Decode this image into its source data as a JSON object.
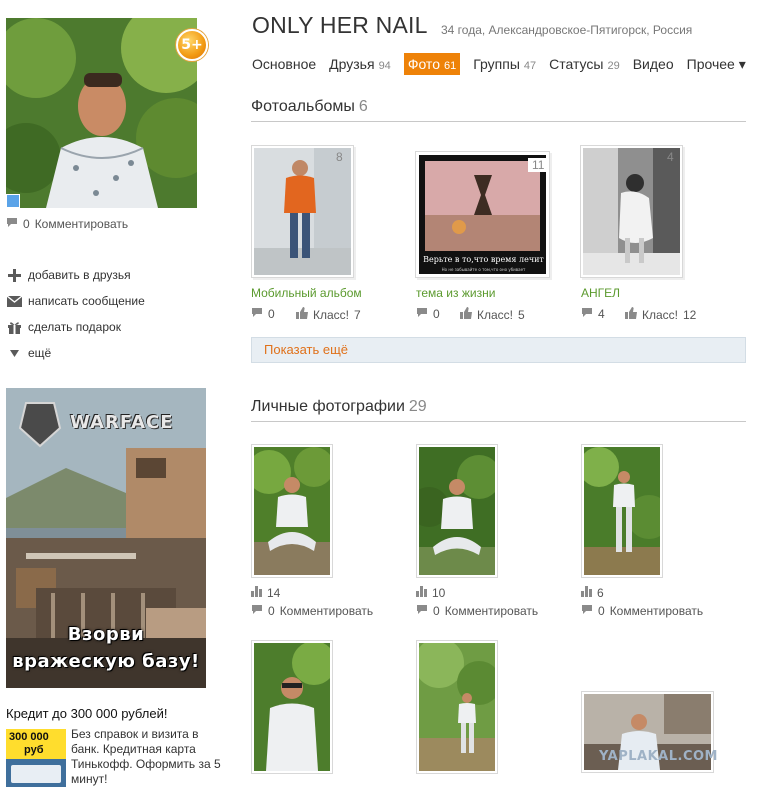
{
  "profile": {
    "name": "ONLY HER NAIL",
    "meta": "34 года, Александровское-Пятигорск, Россия",
    "age_badge": "5+",
    "comment_count": "0",
    "comment_label": "Комментировать"
  },
  "actions": [
    {
      "label": "добавить в друзья",
      "icon": "plus-icon"
    },
    {
      "label": "написать сообщение",
      "icon": "envelope-icon"
    },
    {
      "label": "сделать подарок",
      "icon": "gift-icon"
    },
    {
      "label": "ещё",
      "icon": "triangle-down-icon"
    }
  ],
  "tabs": [
    {
      "label": "Основное",
      "count": ""
    },
    {
      "label": "Друзья",
      "count": "94"
    },
    {
      "label": "Фото",
      "count": "61",
      "active": true
    },
    {
      "label": "Группы",
      "count": "47"
    },
    {
      "label": "Статусы",
      "count": "29"
    },
    {
      "label": "Видео",
      "count": ""
    },
    {
      "label": "Прочее ▾",
      "count": ""
    }
  ],
  "albums_section": {
    "title": "Фотоальбомы",
    "count": "6",
    "albums": [
      {
        "title": "Мобильный альбом",
        "count": "8",
        "comments": "0",
        "likes_label": "Класс!",
        "likes": "7"
      },
      {
        "title": "тема из жизни",
        "count": "11",
        "comments": "0",
        "likes_label": "Класс!",
        "likes": "5"
      },
      {
        "title": "АНГЕЛ",
        "count": "4",
        "comments": "4",
        "likes_label": "Класс!",
        "likes": "12"
      }
    ],
    "more_label": "Показать ещё",
    "poster_line1": "Верьте в то,что время лечит",
    "poster_line2": "Но не забывайте о том,что оно убивает"
  },
  "photos_section": {
    "title": "Личные фотографии",
    "count": "29",
    "photos": [
      {
        "likes": "14",
        "comments": "0",
        "comment_label": "Комментировать"
      },
      {
        "likes": "10",
        "comments": "0",
        "comment_label": "Комментировать"
      },
      {
        "likes": "6",
        "comments": "0",
        "comment_label": "Комментировать"
      }
    ]
  },
  "ad": {
    "brand": "WARFACE",
    "line1": "Взорви",
    "line2": "вражескую базу!"
  },
  "credit": {
    "title": "Кредит до 300 000 рублей!",
    "card_amount": "300 000",
    "card_unit": "руб",
    "description": "Без справок и визита в банк. Кредитная карта Тинькофф. Оформить за 5 минут!"
  },
  "watermark": "YAPLAKAL.COM",
  "colors": {
    "accent_orange": "#ee8208",
    "album_link_green": "#5b9a2e",
    "more_button_bg": "#e8eef3"
  }
}
